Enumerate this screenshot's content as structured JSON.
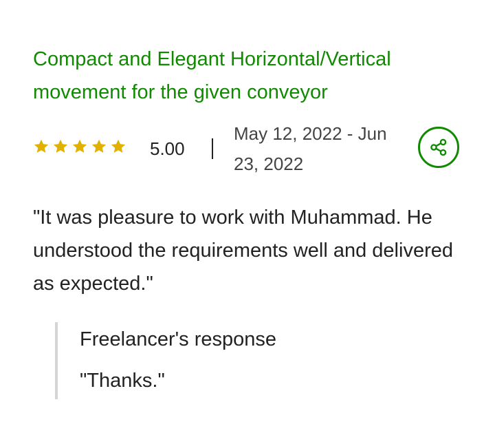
{
  "review": {
    "title": "Compact and Elegant Horizontal/Vertical movement for the given conveyor",
    "rating": {
      "stars": 5,
      "max_stars": 5,
      "value": "5.00"
    },
    "dates": "May 12, 2022 - Jun 23, 2022",
    "comment": "\"It was pleasure to work with Muhammad. He understood the requirements well and delivered as expected.\"",
    "share_icon": "share-icon",
    "response": {
      "heading": "Freelancer's response",
      "text": "\"Thanks.\""
    }
  },
  "colors": {
    "accent": "#108a00",
    "star": "#e0b100",
    "text": "#222222",
    "border": "#d5d5d5"
  }
}
